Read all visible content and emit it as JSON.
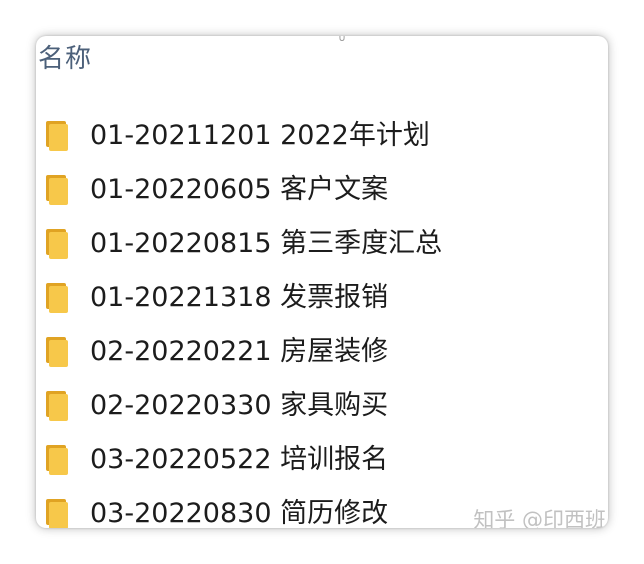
{
  "header": {
    "column_name": "名称",
    "top_mark": "∪"
  },
  "items": [
    {
      "label": "01-20211201 2022年计划",
      "icon": "folder-icon"
    },
    {
      "label": "01-20220605 客户文案",
      "icon": "folder-icon"
    },
    {
      "label": "01-20220815 第三季度汇总",
      "icon": "folder-icon"
    },
    {
      "label": "01-20221318 发票报销",
      "icon": "folder-icon"
    },
    {
      "label": "02-20220221 房屋装修",
      "icon": "folder-icon"
    },
    {
      "label": "02-20220330 家具购买",
      "icon": "folder-icon"
    },
    {
      "label": "03-20220522 培训报名",
      "icon": "folder-icon"
    },
    {
      "label": "03-20220830 简历修改",
      "icon": "folder-icon"
    }
  ],
  "watermark": "知乎 @印西班",
  "colors": {
    "folder_front": "#f7c84a",
    "folder_back": "#e0a323",
    "header_text": "#4c607a"
  }
}
